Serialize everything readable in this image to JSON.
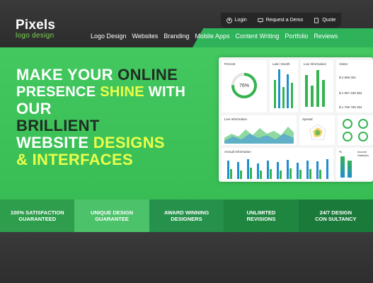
{
  "brand": {
    "name": "Pixels",
    "tagline": "logo design"
  },
  "topbar": {
    "login": "Login",
    "demo": "Request a Demo",
    "quote": "Quote"
  },
  "nav": [
    "Logo Design",
    "Websites",
    "Branding",
    "Mobile Apps",
    "Content Writing",
    "Portfolio",
    "Reviews"
  ],
  "hero": {
    "line1a": "MAKE YOUR ",
    "line1b": "ONLINE",
    "line2a": "PRESENCE ",
    "line2b": "SHINE",
    "line2c": " WITH",
    "line3": "OUR",
    "line4": "BRILLIENT",
    "line5a": "WEBSITE ",
    "line5b": "DESIGNS",
    "line6": "& INTERFACES"
  },
  "dashboard": {
    "percent_title": "Percent",
    "percent_value": "76%",
    "last_month": "Last / Month",
    "live_info": "Live Information",
    "visitor": "Visitor",
    "stats": [
      "$ 2 568 254",
      "$ 1 567 345 654",
      "$ 1 769 756 254"
    ],
    "live_info2": "Live Information",
    "spread": "Spread",
    "annual_info": "Annual Information",
    "pct_label": "%",
    "income": "Income Statistics"
  },
  "features": [
    [
      "100% SATISFACTION",
      "GUARANTEED"
    ],
    [
      "UNIQUE DESIGN",
      "GUARANTEE"
    ],
    [
      "AWARD WINNING",
      "DESIGNERS"
    ],
    [
      "UNLIMITED",
      "REVISIONS"
    ],
    [
      "24/7 DESIGN",
      "CON SULTANCY"
    ]
  ],
  "colors": {
    "green": "#3ec55c",
    "dark": "#2c2c2c",
    "lime": "#7ed957",
    "yellow": "#eaff4a"
  }
}
